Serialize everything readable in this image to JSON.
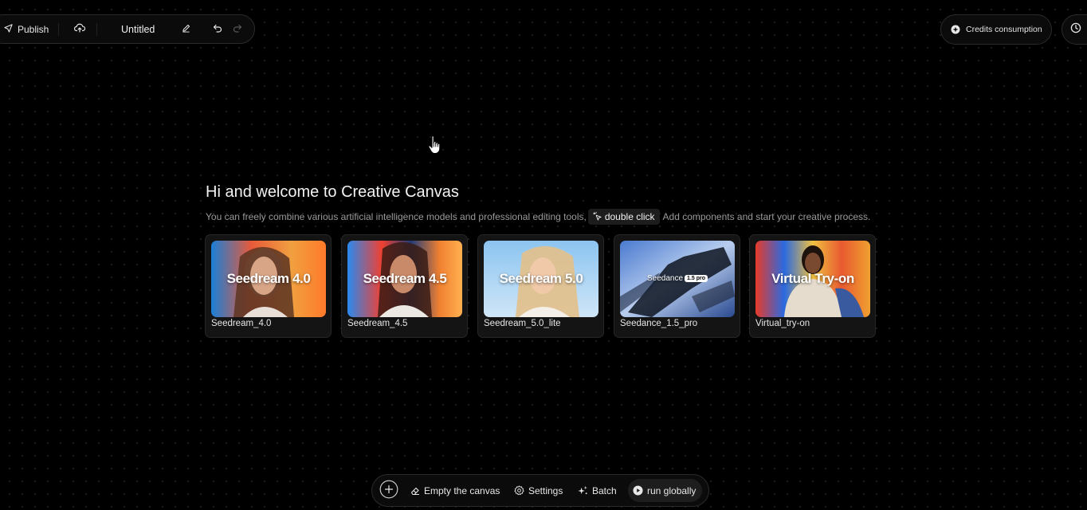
{
  "toolbar": {
    "publish_label": "Publish",
    "title": "Untitled"
  },
  "header_right": {
    "credits_label": "Credits consumption"
  },
  "welcome": {
    "title": "Hi and welcome to Creative Canvas",
    "subtitle_before": "You can freely combine various artificial intelligence models and professional editing tools,",
    "chip_label": "double click",
    "subtitle_after": "Add components and start your creative process."
  },
  "cards": [
    {
      "thumb_title": "Seedream 4.0",
      "label": "Seedream_4.0"
    },
    {
      "thumb_title": "Seedream 4.5",
      "label": "Seedream_4.5"
    },
    {
      "thumb_title": "Seedream 5.0",
      "label": "Seedream_5.0_lite"
    },
    {
      "thumb_title": "Seedance",
      "thumb_badge": "1.5 pro",
      "label": "Seedance_1.5_pro"
    },
    {
      "thumb_title": "Virtual Try-on",
      "label": "Virtual_try-on"
    }
  ],
  "bottom_toolbar": {
    "empty_label": "Empty the canvas",
    "settings_label": "Settings",
    "batch_label": "Batch",
    "run_label": "run globally"
  },
  "icons": {
    "publish": "send-icon",
    "upload": "cloud-upload-icon",
    "edit": "pencil-icon",
    "undo": "undo-icon",
    "redo": "redo-icon",
    "credits": "coin-icon",
    "history": "clock-icon",
    "add": "plus-circle-icon",
    "empty": "eraser-icon",
    "settings": "gear-icon",
    "batch": "sparkles-icon",
    "run": "play-circle-icon"
  },
  "colors": {
    "background": "#000000",
    "panel": "#0b0b0b",
    "border": "#2b2b2b",
    "card": "#141414",
    "text": "#f2f2f2",
    "muted_text": "#9a9a9a"
  }
}
